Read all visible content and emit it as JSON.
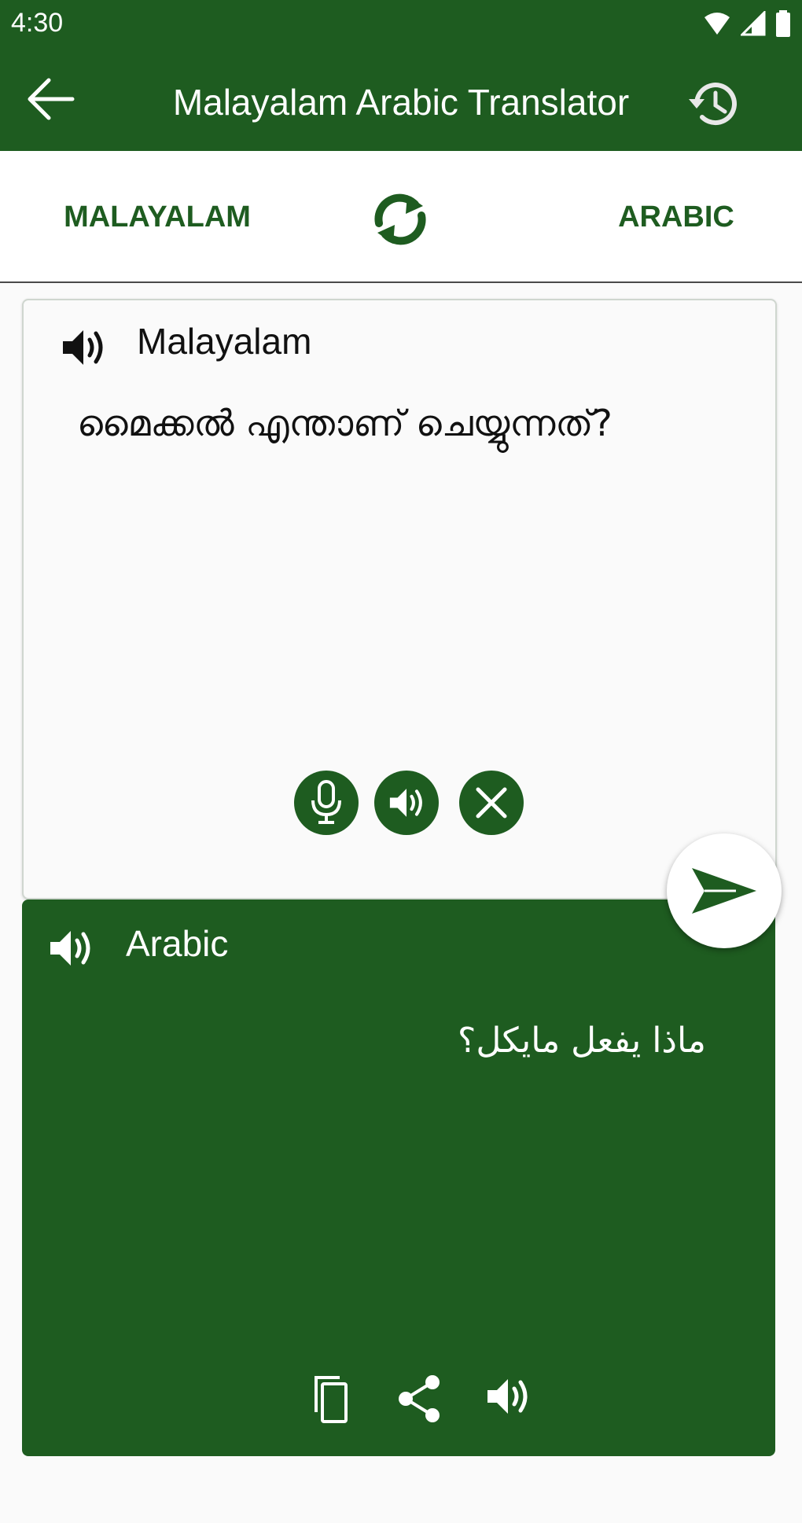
{
  "status_bar": {
    "time": "4:30",
    "icons": [
      "wifi-icon",
      "cell-signal-icon",
      "battery-icon"
    ]
  },
  "app_bar": {
    "title": "Malayalam Arabic Translator",
    "back_icon": "arrow-left-icon",
    "history_icon": "history-icon"
  },
  "language_bar": {
    "source": "MALAYALAM",
    "target": "ARABIC",
    "swap_icon": "swap-icon"
  },
  "input": {
    "language_label": "Malayalam",
    "text": "മൈക്കൽ എന്താണ് ചെയ്യുന്നത്?",
    "actions": [
      "mic-icon",
      "speaker-icon",
      "clear-icon"
    ]
  },
  "output": {
    "language_label": "Arabic",
    "text": "ماذا يفعل مايكل؟",
    "actions": [
      "copy-icon",
      "share-icon",
      "speaker-icon"
    ]
  },
  "send_icon": "send-icon",
  "colors": {
    "primary": "#1e5c20",
    "background": "#fafafa",
    "white": "#ffffff"
  }
}
